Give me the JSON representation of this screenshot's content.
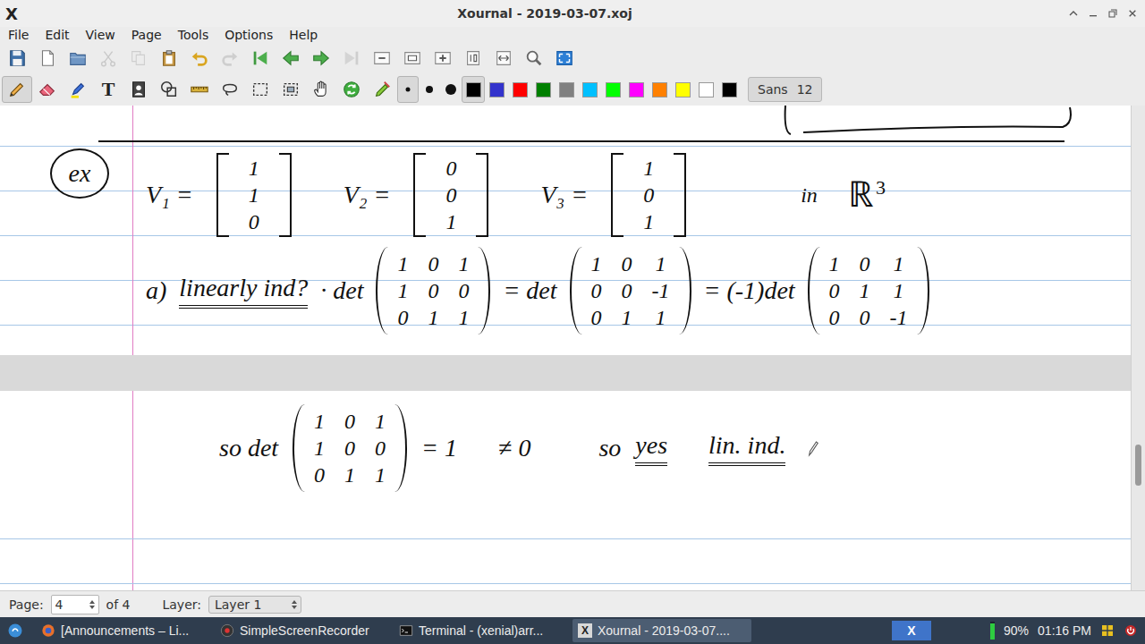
{
  "window": {
    "title": "Xournal - 2019-03-07.xoj",
    "app_glyph": "X"
  },
  "menu": [
    "File",
    "Edit",
    "View",
    "Page",
    "Tools",
    "Options",
    "Help"
  ],
  "toolbar": [
    {
      "kind": "save",
      "disabled": false
    },
    {
      "kind": "new",
      "disabled": false
    },
    {
      "kind": "open",
      "disabled": false
    },
    {
      "kind": "cut",
      "disabled": true
    },
    {
      "kind": "copy",
      "disabled": true
    },
    {
      "kind": "paste",
      "disabled": false
    },
    {
      "kind": "undo",
      "disabled": false
    },
    {
      "kind": "redo",
      "disabled": true
    },
    {
      "kind": "first",
      "disabled": false
    },
    {
      "kind": "prev",
      "disabled": false
    },
    {
      "kind": "next",
      "disabled": false
    },
    {
      "kind": "last",
      "disabled": true
    },
    {
      "kind": "zoomout",
      "disabled": false
    },
    {
      "kind": "zoomfit",
      "disabled": false
    },
    {
      "kind": "zoomin",
      "disabled": false
    },
    {
      "kind": "zoom100",
      "disabled": false
    },
    {
      "kind": "zoomwidth",
      "disabled": false
    },
    {
      "kind": "zoomcustom",
      "disabled": false
    },
    {
      "kind": "fullscreen",
      "disabled": false
    }
  ],
  "tools": [
    {
      "kind": "pen",
      "selected": true
    },
    {
      "kind": "eraser",
      "selected": false
    },
    {
      "kind": "highlighter",
      "selected": false
    },
    {
      "kind": "text",
      "glyph": "T",
      "selected": false
    },
    {
      "kind": "image",
      "selected": false
    },
    {
      "kind": "shape",
      "selected": false
    },
    {
      "kind": "ruler",
      "selected": false
    },
    {
      "kind": "lasso",
      "selected": false
    },
    {
      "kind": "rectselect",
      "selected": false
    },
    {
      "kind": "regionselect",
      "selected": false
    },
    {
      "kind": "hand",
      "selected": false
    },
    {
      "kind": "refresh",
      "selected": false
    },
    {
      "kind": "pensettings",
      "selected": false
    }
  ],
  "sizes": [
    {
      "kind": "fine",
      "selected": true
    },
    {
      "kind": "medium",
      "selected": false
    },
    {
      "kind": "thick",
      "selected": false
    }
  ],
  "colors": [
    {
      "color": "#000000",
      "selected": true
    },
    {
      "color": "#3333cc",
      "selected": false
    },
    {
      "color": "#ff0000",
      "selected": false
    },
    {
      "color": "#008000",
      "selected": false
    },
    {
      "color": "#808080",
      "selected": false
    },
    {
      "color": "#00c0ff",
      "selected": false
    },
    {
      "color": "#00ff00",
      "selected": false
    },
    {
      "color": "#ff00ff",
      "selected": false
    },
    {
      "color": "#ff8000",
      "selected": false
    },
    {
      "color": "#ffff00",
      "selected": false
    },
    {
      "color": "#ffffff",
      "selected": false
    },
    {
      "color": "#000000",
      "selected": false
    }
  ],
  "font": {
    "name": "Sans",
    "size": "12"
  },
  "notes": {
    "example": "ex",
    "vectors": [
      {
        "label": "V₁ =",
        "entries": [
          "1",
          "1",
          "0"
        ]
      },
      {
        "label": "V₂ =",
        "entries": [
          "0",
          "0",
          "1"
        ]
      },
      {
        "label": "V₃ =",
        "entries": [
          "1",
          "0",
          "1"
        ]
      }
    ],
    "space": {
      "prefix": "in",
      "set": "ℝ",
      "power": "3"
    },
    "part_a": {
      "label": "a)",
      "question": "linearly ind?",
      "steps": [
        {
          "prefix": "· det",
          "rows": [
            [
              "1",
              "0",
              "1"
            ],
            [
              "1",
              "0",
              "0"
            ],
            [
              "0",
              "1",
              "1"
            ]
          ]
        },
        {
          "prefix": "= det",
          "rows": [
            [
              "1",
              "0",
              "1"
            ],
            [
              "0",
              "0",
              "-1"
            ],
            [
              "0",
              "1",
              "1"
            ]
          ]
        },
        {
          "prefix": "= (-1)det",
          "rows": [
            [
              "1",
              "0",
              "1"
            ],
            [
              "0",
              "1",
              "1"
            ],
            [
              "0",
              "0",
              "-1"
            ]
          ]
        }
      ]
    },
    "conclusion": {
      "prefix": "so det",
      "rows": [
        [
          "1",
          "0",
          "1"
        ],
        [
          "1",
          "0",
          "0"
        ],
        [
          "0",
          "1",
          "1"
        ]
      ],
      "value": "= 1",
      "relation": "≠ 0",
      "so": "so",
      "answer": "yes",
      "result": "lin. ind."
    }
  },
  "scrollbar": {
    "position": 0.7,
    "size": 0.085
  },
  "status_bar": {
    "page_label": "Page:",
    "page": "4",
    "page_total": "of 4",
    "layer_label": "Layer:",
    "layer": "Layer 1"
  },
  "taskbar": {
    "tasks": [
      {
        "kind": "firefox",
        "label": "[Announcements – Li...",
        "selected": false
      },
      {
        "kind": "recorder",
        "label": "SimpleScreenRecorder",
        "selected": false
      },
      {
        "kind": "terminal",
        "label": "Terminal - (xenial)arr...",
        "selected": false
      },
      {
        "kind": "xournal",
        "glyph": "X",
        "label": "Xournal - 2019-03-07....",
        "selected": true
      }
    ],
    "tray_glyph": "X",
    "battery": {
      "level": 0.9,
      "reading": "90%"
    },
    "clock": "01:16 PM"
  }
}
